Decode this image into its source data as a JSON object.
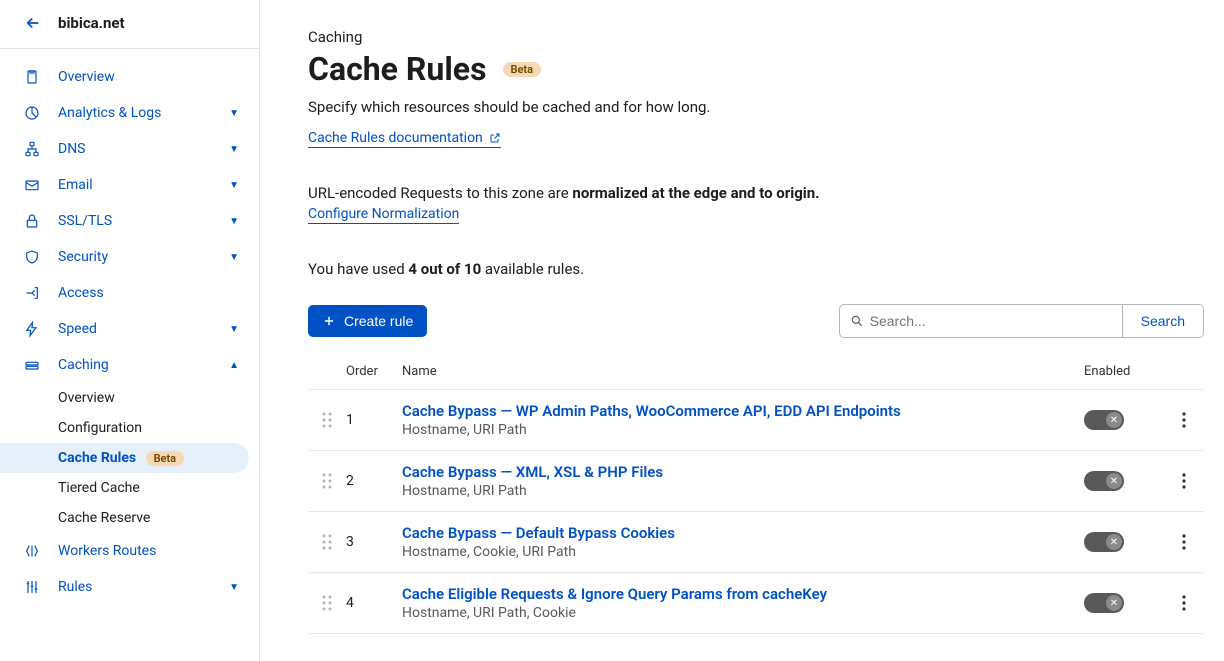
{
  "header": {
    "site": "bibica.net"
  },
  "sidebar": {
    "items": [
      {
        "label": "Overview",
        "icon": "clipboard"
      },
      {
        "label": "Analytics & Logs",
        "icon": "pie",
        "expandable": true
      },
      {
        "label": "DNS",
        "icon": "network",
        "expandable": true
      },
      {
        "label": "Email",
        "icon": "mail",
        "expandable": true
      },
      {
        "label": "SSL/TLS",
        "icon": "lock",
        "expandable": true
      },
      {
        "label": "Security",
        "icon": "shield",
        "expandable": true
      },
      {
        "label": "Access",
        "icon": "access"
      },
      {
        "label": "Speed",
        "icon": "bolt",
        "expandable": true
      },
      {
        "label": "Caching",
        "icon": "drive",
        "expandable": true,
        "expanded": true,
        "children": [
          {
            "label": "Overview"
          },
          {
            "label": "Configuration"
          },
          {
            "label": "Cache Rules",
            "active": true,
            "badge": "Beta"
          },
          {
            "label": "Tiered Cache"
          },
          {
            "label": "Cache Reserve"
          }
        ]
      },
      {
        "label": "Workers Routes",
        "icon": "workers"
      },
      {
        "label": "Rules",
        "icon": "rules",
        "expandable": true
      }
    ]
  },
  "main": {
    "breadcrumb": "Caching",
    "title": "Cache Rules",
    "title_badge": "Beta",
    "description": "Specify which resources should be cached and for how long.",
    "doc_link": "Cache Rules documentation",
    "normalization_prefix": "URL-encoded Requests to this zone are ",
    "normalization_bold": "normalized at the edge and to origin.",
    "configure_norm": "Configure Normalization",
    "usage_prefix": "You have used ",
    "usage_bold": "4 out of 10",
    "usage_suffix": " available rules.",
    "create_label": "Create rule",
    "search_placeholder": "Search...",
    "search_button": "Search",
    "columns": {
      "order": "Order",
      "name": "Name",
      "enabled": "Enabled"
    },
    "rules": [
      {
        "order": "1",
        "name": "Cache Bypass — WP Admin Paths, WooCommerce API, EDD API Endpoints",
        "fields": "Hostname, URI Path",
        "enabled": false
      },
      {
        "order": "2",
        "name": "Cache Bypass — XML, XSL & PHP Files",
        "fields": "Hostname, URI Path",
        "enabled": false
      },
      {
        "order": "3",
        "name": "Cache Bypass — Default Bypass Cookies",
        "fields": "Hostname, Cookie, URI Path",
        "enabled": false
      },
      {
        "order": "4",
        "name": "Cache Eligible Requests & Ignore Query Params from cacheKey",
        "fields": "Hostname, URI Path, Cookie",
        "enabled": false
      }
    ]
  }
}
